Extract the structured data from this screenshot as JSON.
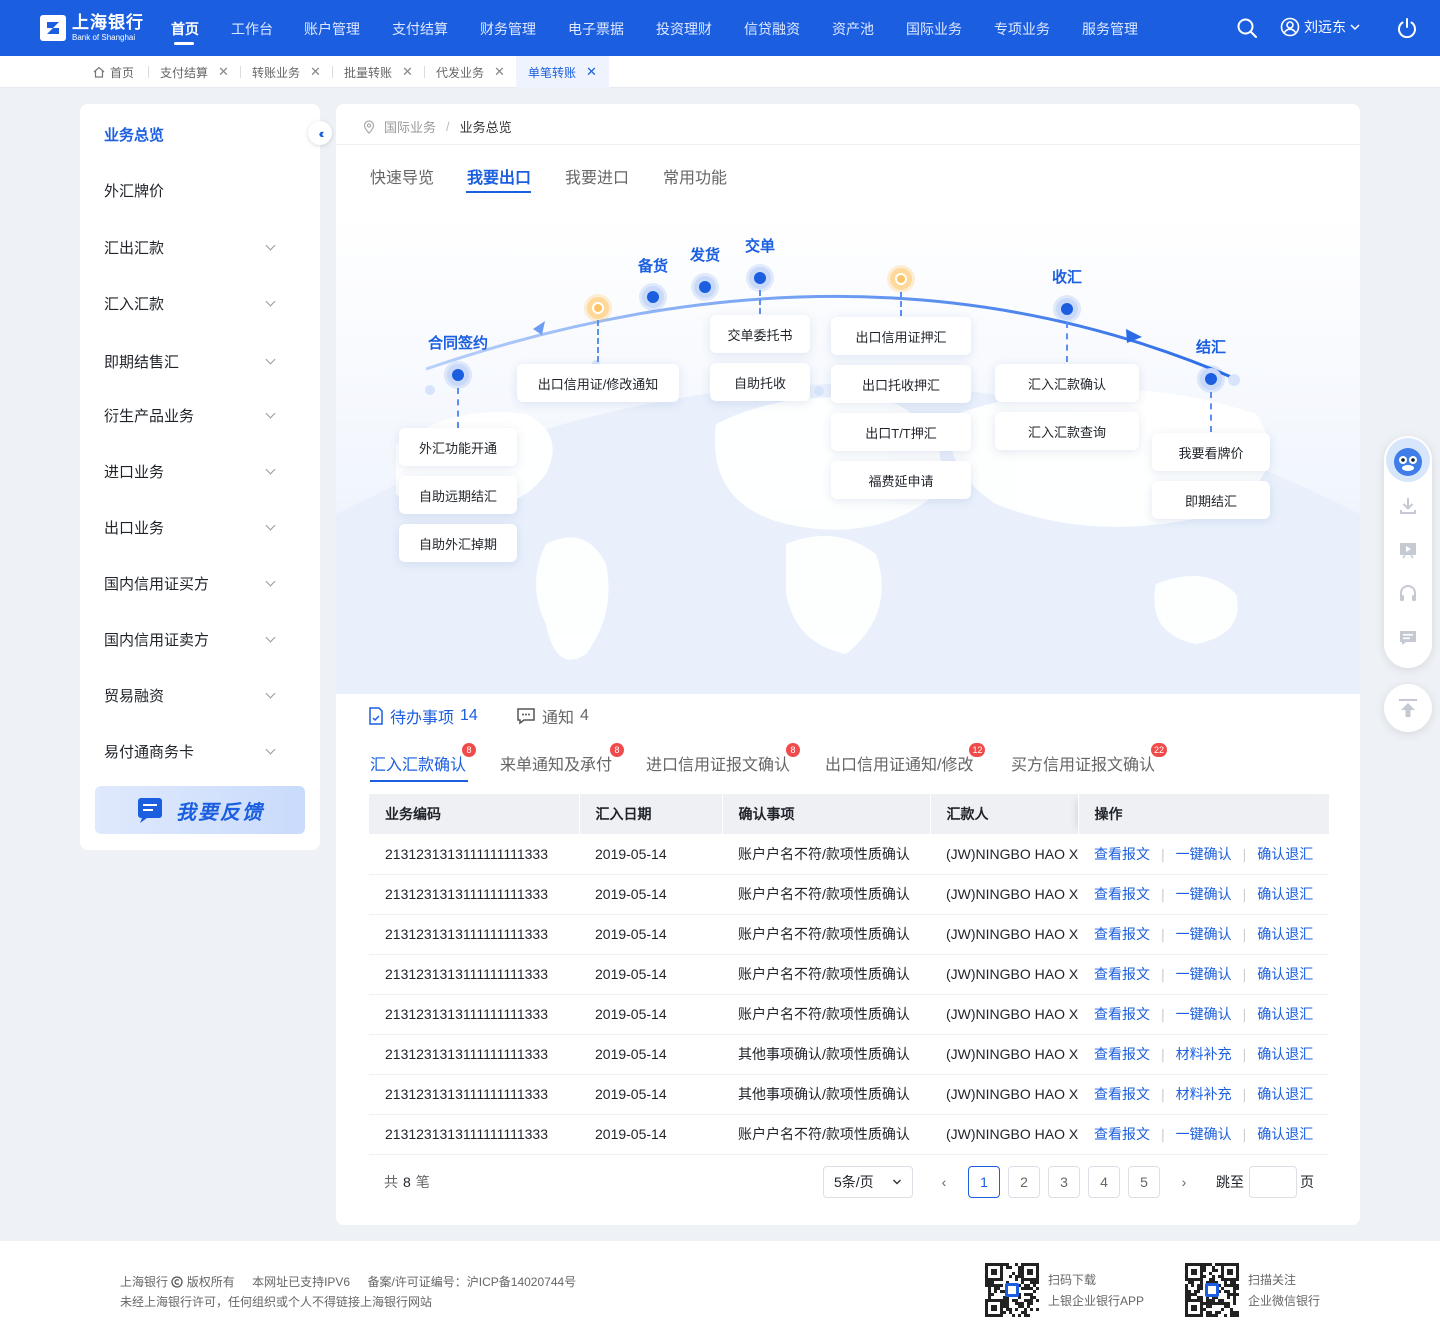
{
  "brand": {
    "cn": "上海银行",
    "en": "Bank of Shanghai",
    "logo_icon": "bank-logo-icon"
  },
  "topnav": {
    "items": [
      "首页",
      "工作台",
      "账户管理",
      "支付结算",
      "财务管理",
      "电子票据",
      "投资理财",
      "信贷融资",
      "资产池",
      "国际业务",
      "专项业务",
      "服务管理"
    ],
    "active": "首页",
    "user": "刘远东",
    "colors": {
      "primary": "#1b5fe0"
    }
  },
  "page_tabs": [
    {
      "label": "首页",
      "closable": false
    },
    {
      "label": "支付结算",
      "closable": true
    },
    {
      "label": "转账业务",
      "closable": true
    },
    {
      "label": "批量转账",
      "closable": true
    },
    {
      "label": "代发业务",
      "closable": true
    },
    {
      "label": "单笔转账",
      "closable": true,
      "active": true
    }
  ],
  "close_glyph": "✕",
  "sidebar": {
    "items": [
      "业务总览",
      "外汇牌价",
      "汇出汇款",
      "汇入汇款",
      "即期结售汇",
      "衍生产品业务",
      "进口业务",
      "出口业务",
      "国内信用证买方",
      "国内信用证卖方",
      "贸易融资",
      "易付通商务卡"
    ],
    "active": "业务总览",
    "feedback": "我要反馈"
  },
  "breadcrumb": {
    "parent": "国际业务",
    "sep": "/",
    "current": "业务总览"
  },
  "main_tabs": [
    "快速导览",
    "我要出口",
    "我要进口",
    "常用功能"
  ],
  "main_tab_active": "我要出口",
  "flow": {
    "stages": [
      "合同签约",
      "备货",
      "发货",
      "交单",
      "收汇",
      "结汇"
    ],
    "cards": {
      "contract": [
        "外汇功能开通",
        "自助远期结汇",
        "自助外汇掉期"
      ],
      "lc_notice": [
        "出口信用证/修改通知"
      ],
      "delivery": [
        "交单委托书",
        "自助托收"
      ],
      "lc": [
        "出口信用证押汇",
        "出口托收押汇",
        "出口T/T押汇",
        "福费延申请"
      ],
      "receive": [
        "汇入汇款确认",
        "汇入汇款查询"
      ],
      "settle": [
        "我要看牌价",
        "即期结汇"
      ]
    }
  },
  "todo": {
    "label": "待办事项",
    "count": "14",
    "notice_label": "通知",
    "notice_count": "4"
  },
  "todo_tabs": [
    {
      "label": "汇入汇款确认",
      "badge": "8"
    },
    {
      "label": "来单通知及承付",
      "badge": "8"
    },
    {
      "label": "进口信用证报文确认",
      "badge": "8"
    },
    {
      "label": "出口信用证通知/修改",
      "badge": "12"
    },
    {
      "label": "买方信用证报文确认",
      "badge": "22"
    }
  ],
  "table": {
    "headers": [
      "业务编码",
      "汇入日期",
      "确认事项",
      "汇款人",
      "操作"
    ],
    "rows": [
      {
        "code": "2131231313111111111333",
        "date": "2019-05-14",
        "item": "账户户名不符/款项性质确认",
        "payer": "(JW)NINGBO HAO XI",
        "ops": [
          "查看报文",
          "一键确认",
          "确认退汇"
        ]
      },
      {
        "code": "2131231313111111111333",
        "date": "2019-05-14",
        "item": "账户户名不符/款项性质确认",
        "payer": "(JW)NINGBO HAO XI",
        "ops": [
          "查看报文",
          "一键确认",
          "确认退汇"
        ]
      },
      {
        "code": "2131231313111111111333",
        "date": "2019-05-14",
        "item": "账户户名不符/款项性质确认",
        "payer": "(JW)NINGBO HAO XI",
        "ops": [
          "查看报文",
          "一键确认",
          "确认退汇"
        ]
      },
      {
        "code": "2131231313111111111333",
        "date": "2019-05-14",
        "item": "账户户名不符/款项性质确认",
        "payer": "(JW)NINGBO HAO XI",
        "ops": [
          "查看报文",
          "一键确认",
          "确认退汇"
        ]
      },
      {
        "code": "2131231313111111111333",
        "date": "2019-05-14",
        "item": "账户户名不符/款项性质确认",
        "payer": "(JW)NINGBO HAO XI",
        "ops": [
          "查看报文",
          "一键确认",
          "确认退汇"
        ]
      },
      {
        "code": "2131231313111111111333",
        "date": "2019-05-14",
        "item": "其他事项确认/款项性质确认",
        "payer": "(JW)NINGBO HAO XI",
        "ops": [
          "查看报文",
          "材料补充",
          "确认退汇"
        ]
      },
      {
        "code": "2131231313111111111333",
        "date": "2019-05-14",
        "item": "其他事项确认/款项性质确认",
        "payer": "(JW)NINGBO HAO XI",
        "ops": [
          "查看报文",
          "材料补充",
          "确认退汇"
        ]
      },
      {
        "code": "2131231313111111111333",
        "date": "2019-05-14",
        "item": "账户户名不符/款项性质确认",
        "payer": "(JW)NINGBO HAO XI",
        "ops": [
          "查看报文",
          "一键确认",
          "确认退汇"
        ]
      }
    ]
  },
  "pagination": {
    "total_prefix": "共",
    "total": "8",
    "total_suffix": "笔",
    "page_size": "5条/页",
    "pages": [
      "1",
      "2",
      "3",
      "4",
      "5"
    ],
    "current": "1",
    "prev": "‹",
    "next": "›",
    "jump_label": "跳至",
    "jump_suffix": "页"
  },
  "footer": {
    "line1a": "上海银行",
    "line1b": "版权所有",
    "line1c": "本网址已支持IPV6",
    "line1d": "备案/许可证编号：沪ICP备14020744号",
    "line2": "未经上海银行许可，任何组织或个人不得链接上海银行网站",
    "qr1_title": "扫码下载",
    "qr1_sub": "上银企业银行APP",
    "qr2_title": "扫描关注",
    "qr2_sub": "企业微信银行"
  },
  "float_icons": [
    "assistant-avatar-icon",
    "download-icon",
    "video-icon",
    "headset-icon",
    "chat-icon",
    "back-to-top-icon"
  ]
}
